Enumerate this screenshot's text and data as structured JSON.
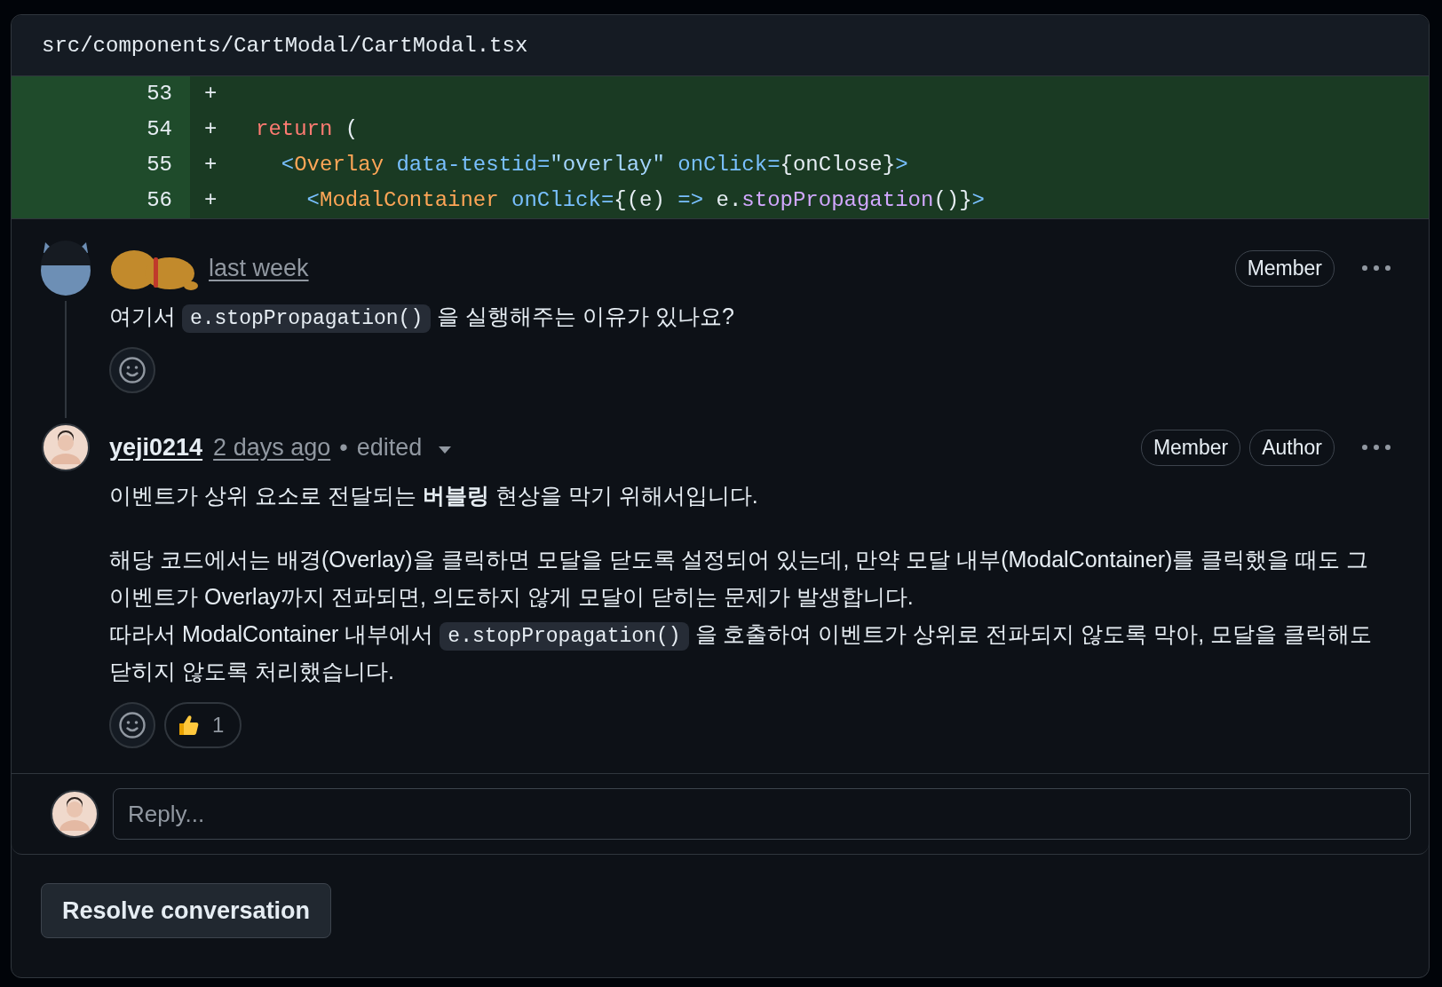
{
  "file": {
    "path": "src/components/CartModal/CartModal.tsx"
  },
  "diff_lines": [
    {
      "number": "53",
      "sign": "+"
    },
    {
      "number": "54",
      "sign": "+",
      "tokens": [
        {
          "kind": "keyword",
          "text": "return"
        },
        {
          "kind": "plain",
          "text": " ("
        }
      ]
    },
    {
      "number": "55",
      "sign": "+",
      "tokens": [
        {
          "kind": "punct",
          "text": "  <"
        },
        {
          "kind": "tag",
          "text": "Overlay"
        },
        {
          "kind": "attr",
          "text": " data-testid="
        },
        {
          "kind": "string",
          "text": "\"overlay\""
        },
        {
          "kind": "attr",
          "text": " onClick="
        },
        {
          "kind": "plain",
          "text": "{onClose}"
        },
        {
          "kind": "punct",
          "text": ">"
        }
      ]
    },
    {
      "number": "56",
      "sign": "+",
      "tokens": [
        {
          "kind": "punct",
          "text": "    <"
        },
        {
          "kind": "tag",
          "text": "ModalContainer"
        },
        {
          "kind": "attr",
          "text": " onClick="
        },
        {
          "kind": "plain",
          "text": "{(e) "
        },
        {
          "kind": "punct",
          "text": "=>"
        },
        {
          "kind": "plain",
          "text": " e."
        },
        {
          "kind": "func",
          "text": "stopPropagation"
        },
        {
          "kind": "plain",
          "text": "()}"
        },
        {
          "kind": "punct",
          "text": ">"
        }
      ]
    }
  ],
  "comments": [
    {
      "author": {
        "kind": "sticker"
      },
      "time": "last week",
      "badges": [
        "Member"
      ],
      "body": [
        [
          [
            {
              "kind": "text",
              "text": "여기서 "
            },
            {
              "kind": "code",
              "text": "e.stopPropagation()"
            },
            {
              "kind": "text",
              "text": " 을 실행해주는 이유가 있나요?"
            }
          ]
        ]
      ]
    },
    {
      "author": {
        "kind": "name",
        "text": "yeji0214"
      },
      "time": "2 days ago",
      "edited": {
        "separator": "•",
        "label": "edited"
      },
      "badges": [
        "Member",
        "Author"
      ],
      "body": [
        [
          [
            {
              "kind": "text",
              "text": "이벤트가 상위 요소로 전달되는 **버블링** 현상을 막기 위해서입니다."
            }
          ]
        ],
        [
          [
            {
              "kind": "text",
              "text": "해당 코드에서는 배경(Overlay)을 클릭하면 모달을 닫도록 설정되어 있는데, 만약 모달 내부(ModalContainer)를 클릭했을 때도 그 이벤트가 Overlay까지 전파되면, 의도하지 않게 모달이 닫히는 문제가 발생합니다."
            }
          ],
          [
            {
              "kind": "text",
              "text": "따라서 ModalContainer 내부에서 "
            },
            {
              "kind": "code",
              "text": "e.stopPropagation()"
            },
            {
              "kind": "text",
              "text": " 을 호출하여 이벤트가 상위로 전파되지 않도록 막아, 모달을 클릭해도 닫히지 않도록 처리했습니다."
            }
          ]
        ]
      ],
      "reactions": [
        {
          "kind": "thumbs_up",
          "count": "1"
        }
      ]
    }
  ],
  "reply": {
    "placeholder": "Reply..."
  },
  "resolve_button": "Resolve conversation"
}
